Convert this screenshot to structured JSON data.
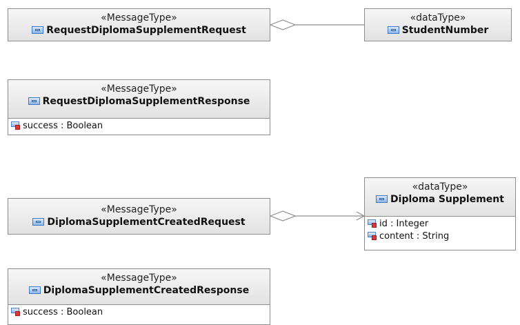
{
  "classes": {
    "request_diploma_supplement_request": {
      "stereotype": "«MessageType»",
      "name": "RequestDiplomaSupplementRequest",
      "attributes": []
    },
    "student_number": {
      "stereotype": "«dataType»",
      "name": "StudentNumber",
      "attributes": []
    },
    "request_diploma_supplement_response": {
      "stereotype": "«MessageType»",
      "name": "RequestDiplomaSupplementResponse",
      "attributes": [
        "success : Boolean"
      ]
    },
    "diploma_supplement_created_request": {
      "stereotype": "«MessageType»",
      "name": "DiplomaSupplementCreatedRequest",
      "attributes": []
    },
    "diploma_supplement": {
      "stereotype": "«dataType»",
      "name": "Diploma Supplement",
      "attributes": [
        "id : Integer",
        "content : String"
      ]
    },
    "diploma_supplement_created_response": {
      "stereotype": "«MessageType»",
      "name": "DiplomaSupplementCreatedResponse",
      "attributes": [
        "success : Boolean"
      ]
    }
  },
  "connectors": [
    {
      "from": "RequestDiplomaSupplementRequest",
      "to": "StudentNumber",
      "kind": "aggregation"
    },
    {
      "from": "DiplomaSupplementCreatedRequest",
      "to": "Diploma Supplement",
      "kind": "aggregation"
    }
  ],
  "colors": {
    "border": "#8c8c8c",
    "header_top": "#f6f6f6",
    "header_bottom": "#e2e2e2",
    "connector": "#8c8c8c"
  }
}
